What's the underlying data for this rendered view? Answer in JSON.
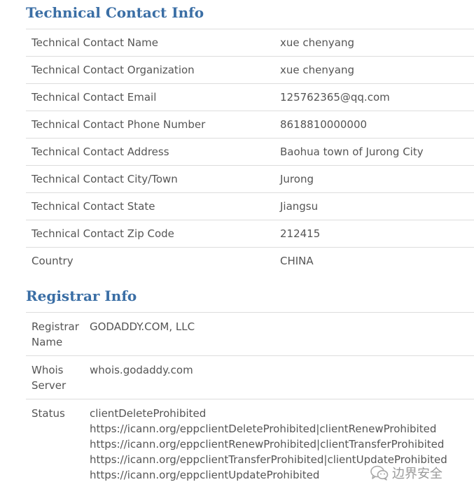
{
  "technical": {
    "title": "Technical Contact Info",
    "rows": [
      {
        "label": "Technical Contact Name",
        "value": "xue chenyang"
      },
      {
        "label": "Technical Contact Organization",
        "value": "xue chenyang"
      },
      {
        "label": "Technical Contact Email",
        "value": "125762365@qq.com"
      },
      {
        "label": "Technical Contact Phone Number",
        "value": "8618810000000"
      },
      {
        "label": "Technical Contact Address",
        "value": "Baohua town of Jurong City"
      },
      {
        "label": "Technical Contact City/Town",
        "value": "Jurong"
      },
      {
        "label": "Technical Contact State",
        "value": "Jiangsu"
      },
      {
        "label": "Technical Contact Zip Code",
        "value": "212415"
      },
      {
        "label": "Country",
        "value": "CHINA"
      }
    ]
  },
  "registrar": {
    "title": "Registrar Info",
    "name_label": "Registrar Name",
    "name_value": "GODADDY.COM, LLC",
    "whois_label": "Whois Server",
    "whois_value": "whois.godaddy.com",
    "status_label": "Status",
    "status_lines": [
      "clientDeleteProhibited",
      "https://icann.org/eppclientDeleteProhibited|clientRenewProhibited",
      "https://icann.org/eppclientRenewProhibited|clientTransferProhibited",
      "https://icann.org/eppclientTransferProhibited|clientUpdateProhibited",
      "https://icann.org/eppclientUpdateProhibited"
    ]
  },
  "watermark": {
    "text": "边界安全",
    "icon": "wechat-icon"
  },
  "colors": {
    "title": "#3a6ea5",
    "text": "#555555",
    "border": "#dddddd"
  }
}
